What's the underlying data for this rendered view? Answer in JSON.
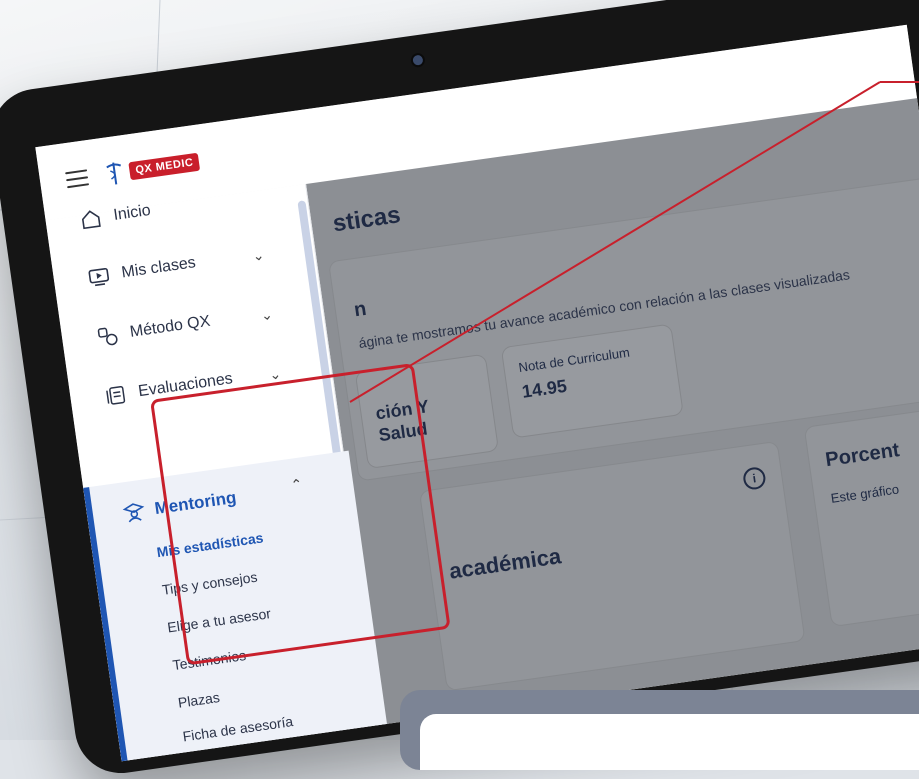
{
  "app": {
    "logo_text": "QX MEDIC",
    "brand_color": "#c91f2b",
    "accent_color": "#1f56b3"
  },
  "sidebar": {
    "items": [
      {
        "label": "Inicio",
        "icon": "home-icon"
      },
      {
        "label": "Mis clases",
        "icon": "video-lesson-icon"
      },
      {
        "label": "Método QX",
        "icon": "method-icon"
      },
      {
        "label": "Evaluaciones",
        "icon": "evaluation-icon"
      }
    ],
    "mentoring": {
      "label": "Mentoring",
      "icon": "graduate-icon",
      "subitems": [
        {
          "label": "Mis estadísticas",
          "active": true
        },
        {
          "label": "Tips y consejos"
        },
        {
          "label": "Elige a tu asesor"
        },
        {
          "label": "Testimonios"
        },
        {
          "label": "Plazas"
        },
        {
          "label": "Ficha de asesoría"
        }
      ]
    }
  },
  "main": {
    "title_fragment": "sticas",
    "section_letter": "n",
    "intro_text": "ágina te mostramos tu avance académico con relación a las clases visualizadas",
    "card_a": {
      "line1": "ción Y",
      "line2": "Salud"
    },
    "card_b": {
      "label": "Nota de Curriculum",
      "value": "14.95"
    },
    "progress_card_title": "académica",
    "percent_card_title": "Porcent",
    "percent_card_subtitle": "Este gráfico"
  }
}
